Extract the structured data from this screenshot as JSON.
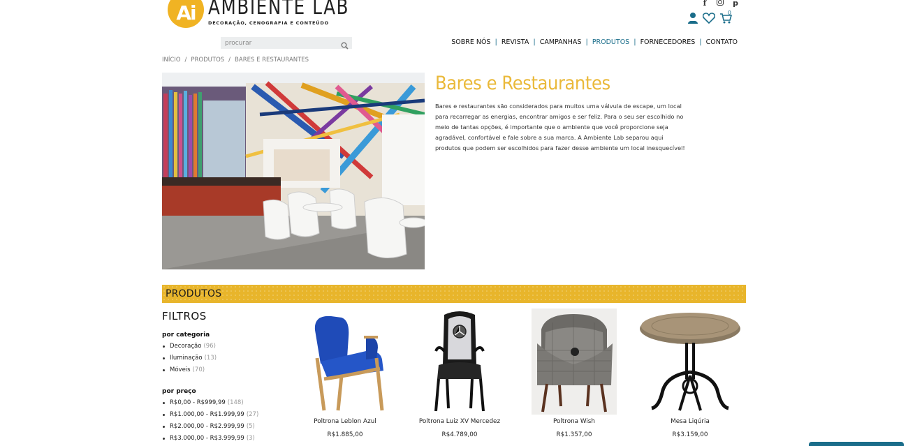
{
  "header": {
    "logo_mark": "Ai",
    "logo_name": "AMBIENTE LAB",
    "logo_tagline": "DECORAÇÃO, CENOGRAFIA E CONTEÚDO",
    "search_placeholder": "procurar",
    "cart_count": "0",
    "social": [
      "facebook-icon",
      "instagram-icon",
      "pinterest-icon"
    ],
    "nav": [
      {
        "label": "SOBRE NÓS",
        "active": false
      },
      {
        "label": "REVISTA",
        "active": false
      },
      {
        "label": "CAMPANHAS",
        "active": false
      },
      {
        "label": "PRODUTOS",
        "active": true
      },
      {
        "label": "FORNECEDORES",
        "active": false
      },
      {
        "label": "CONTATO",
        "active": false
      }
    ]
  },
  "breadcrumb": [
    "INÍCIO",
    "PRODUTOS",
    "BARES E RESTAURANTES"
  ],
  "hero": {
    "title": "Bares e Restaurantes",
    "description": "Bares e restaurantes são considerados para muitos uma válvula de escape, um local para recarregar as energias, encontrar amigos e ser feliz. Para o seu ser escolhido no meio de tantas opções, é importante que o ambiente que você proporcione seja agradável, confortável e fale sobre a sua marca. A Ambiente Lab separou aqui produtos que podem ser escolhidos para fazer desse ambiente um local inesquecível!"
  },
  "products_section": {
    "heading": "PRODUTOS",
    "filters_title": "FILTROS",
    "by_category_label": "por categoria",
    "categories": [
      {
        "label": "Decoração",
        "count": "(96)"
      },
      {
        "label": "Iluminação",
        "count": "(13)"
      },
      {
        "label": "Móveis",
        "count": "(70)"
      }
    ],
    "by_price_label": "por preço",
    "prices": [
      {
        "label": "R$0,00 - R$999,99",
        "count": "(148)"
      },
      {
        "label": "R$1.000,00 - R$1.999,99",
        "count": "(27)"
      },
      {
        "label": "R$2.000,00 - R$2.999,99",
        "count": "(5)"
      },
      {
        "label": "R$3.000,00 - R$3.999,99",
        "count": "(3)"
      }
    ],
    "items": [
      {
        "name": "Poltrona Leblon Azul",
        "price": "R$1.885,00"
      },
      {
        "name": "Poltrona Luiz XV Mercedez",
        "price": "R$4.789,00"
      },
      {
        "name": "Poltrona Wish",
        "price": "R$1.357,00"
      },
      {
        "name": "Mesa Liqúria",
        "price": "R$3.159,00"
      }
    ]
  },
  "colors": {
    "accent_yellow": "#e8b52b",
    "accent_blue": "#1a6d8a",
    "title_yellow": "#eab93a"
  }
}
